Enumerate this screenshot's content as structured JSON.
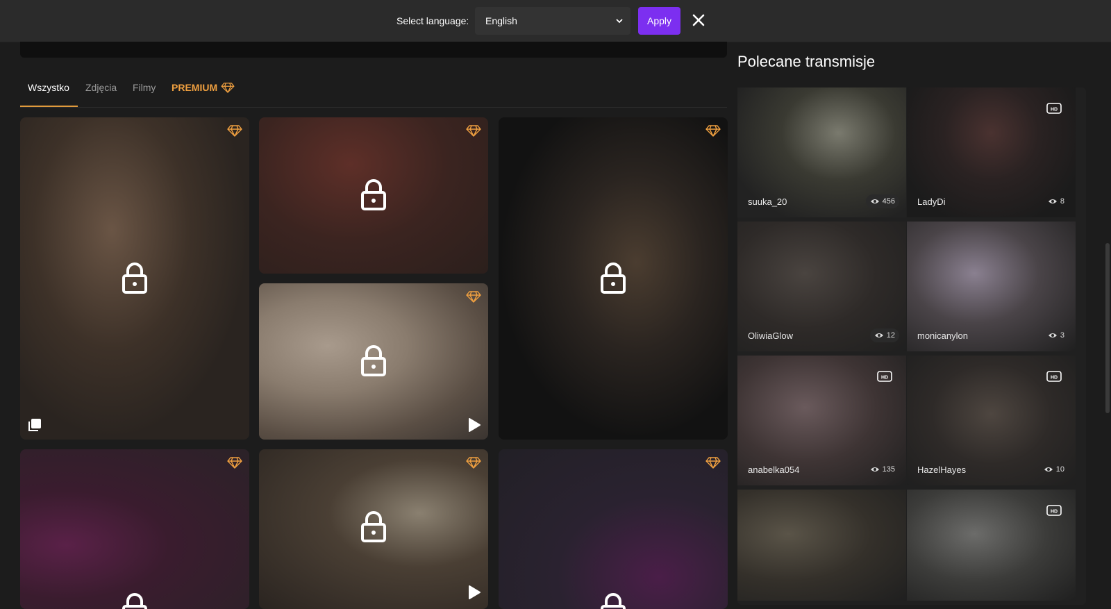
{
  "language_bar": {
    "label": "Select language:",
    "selected": "English",
    "apply_label": "Apply"
  },
  "tabs": [
    {
      "label": "Wszystko",
      "active": true
    },
    {
      "label": "Zdjęcia",
      "active": false
    },
    {
      "label": "Filmy",
      "active": false
    },
    {
      "label": "PREMIUM",
      "active": false
    }
  ],
  "colors": {
    "accent": "#7c2ff0",
    "premium": "#f0a040",
    "background": "#1c1c1c"
  },
  "right_panel": {
    "title": "Polecane transmisje",
    "streams": [
      {
        "name": "suuka_20",
        "viewers": "456",
        "hd": false
      },
      {
        "name": "LadyDi",
        "viewers": "8",
        "hd": true
      },
      {
        "name": "OliwiaGlow",
        "viewers": "12",
        "hd": false
      },
      {
        "name": "monicanylon",
        "viewers": "3",
        "hd": false
      },
      {
        "name": "anabelka054",
        "viewers": "135",
        "hd": true
      },
      {
        "name": "HazelHayes",
        "viewers": "10",
        "hd": true
      },
      {
        "name": "",
        "viewers": "",
        "hd": false
      },
      {
        "name": "",
        "viewers": "",
        "hd": true
      }
    ]
  },
  "icons": {
    "premium": "gem-icon",
    "locked": "lock-icon",
    "gallery": "gallery-icon",
    "video": "play-icon",
    "viewers": "eye-icon",
    "hd": "hd-icon",
    "close": "close-icon"
  }
}
